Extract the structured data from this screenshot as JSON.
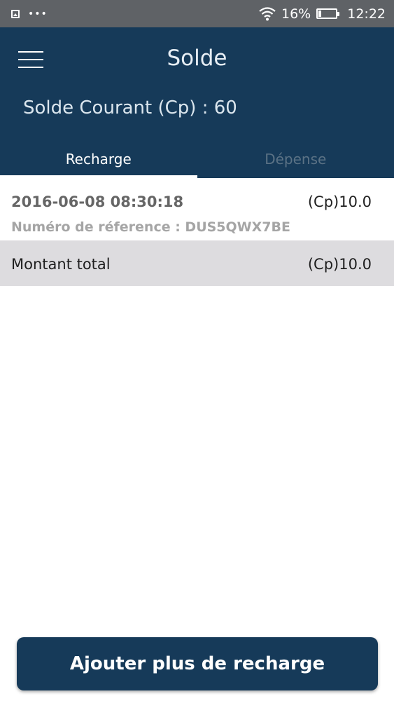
{
  "status_bar": {
    "battery_percent": "16%",
    "battery_level": 0.16,
    "time": "12:22",
    "icons": [
      "image-icon",
      "more-dots-icon",
      "wifi-icon",
      "battery-icon"
    ]
  },
  "header": {
    "title": "Solde",
    "balance": "Solde Courant (Cp) : 60",
    "background_color": "#163a59"
  },
  "tabs": [
    {
      "label": "Recharge",
      "active": true
    },
    {
      "label": "Dépense",
      "active": false
    }
  ],
  "transactions": [
    {
      "date": "2016-06-08 08:30:18",
      "amount": "(Cp)10.0",
      "reference": "Numéro de réference : DUS5QWX7BE"
    }
  ],
  "total": {
    "label": "Montant total",
    "amount": "(Cp)10.0"
  },
  "footer": {
    "button_label": "Ajouter plus de recharge"
  }
}
